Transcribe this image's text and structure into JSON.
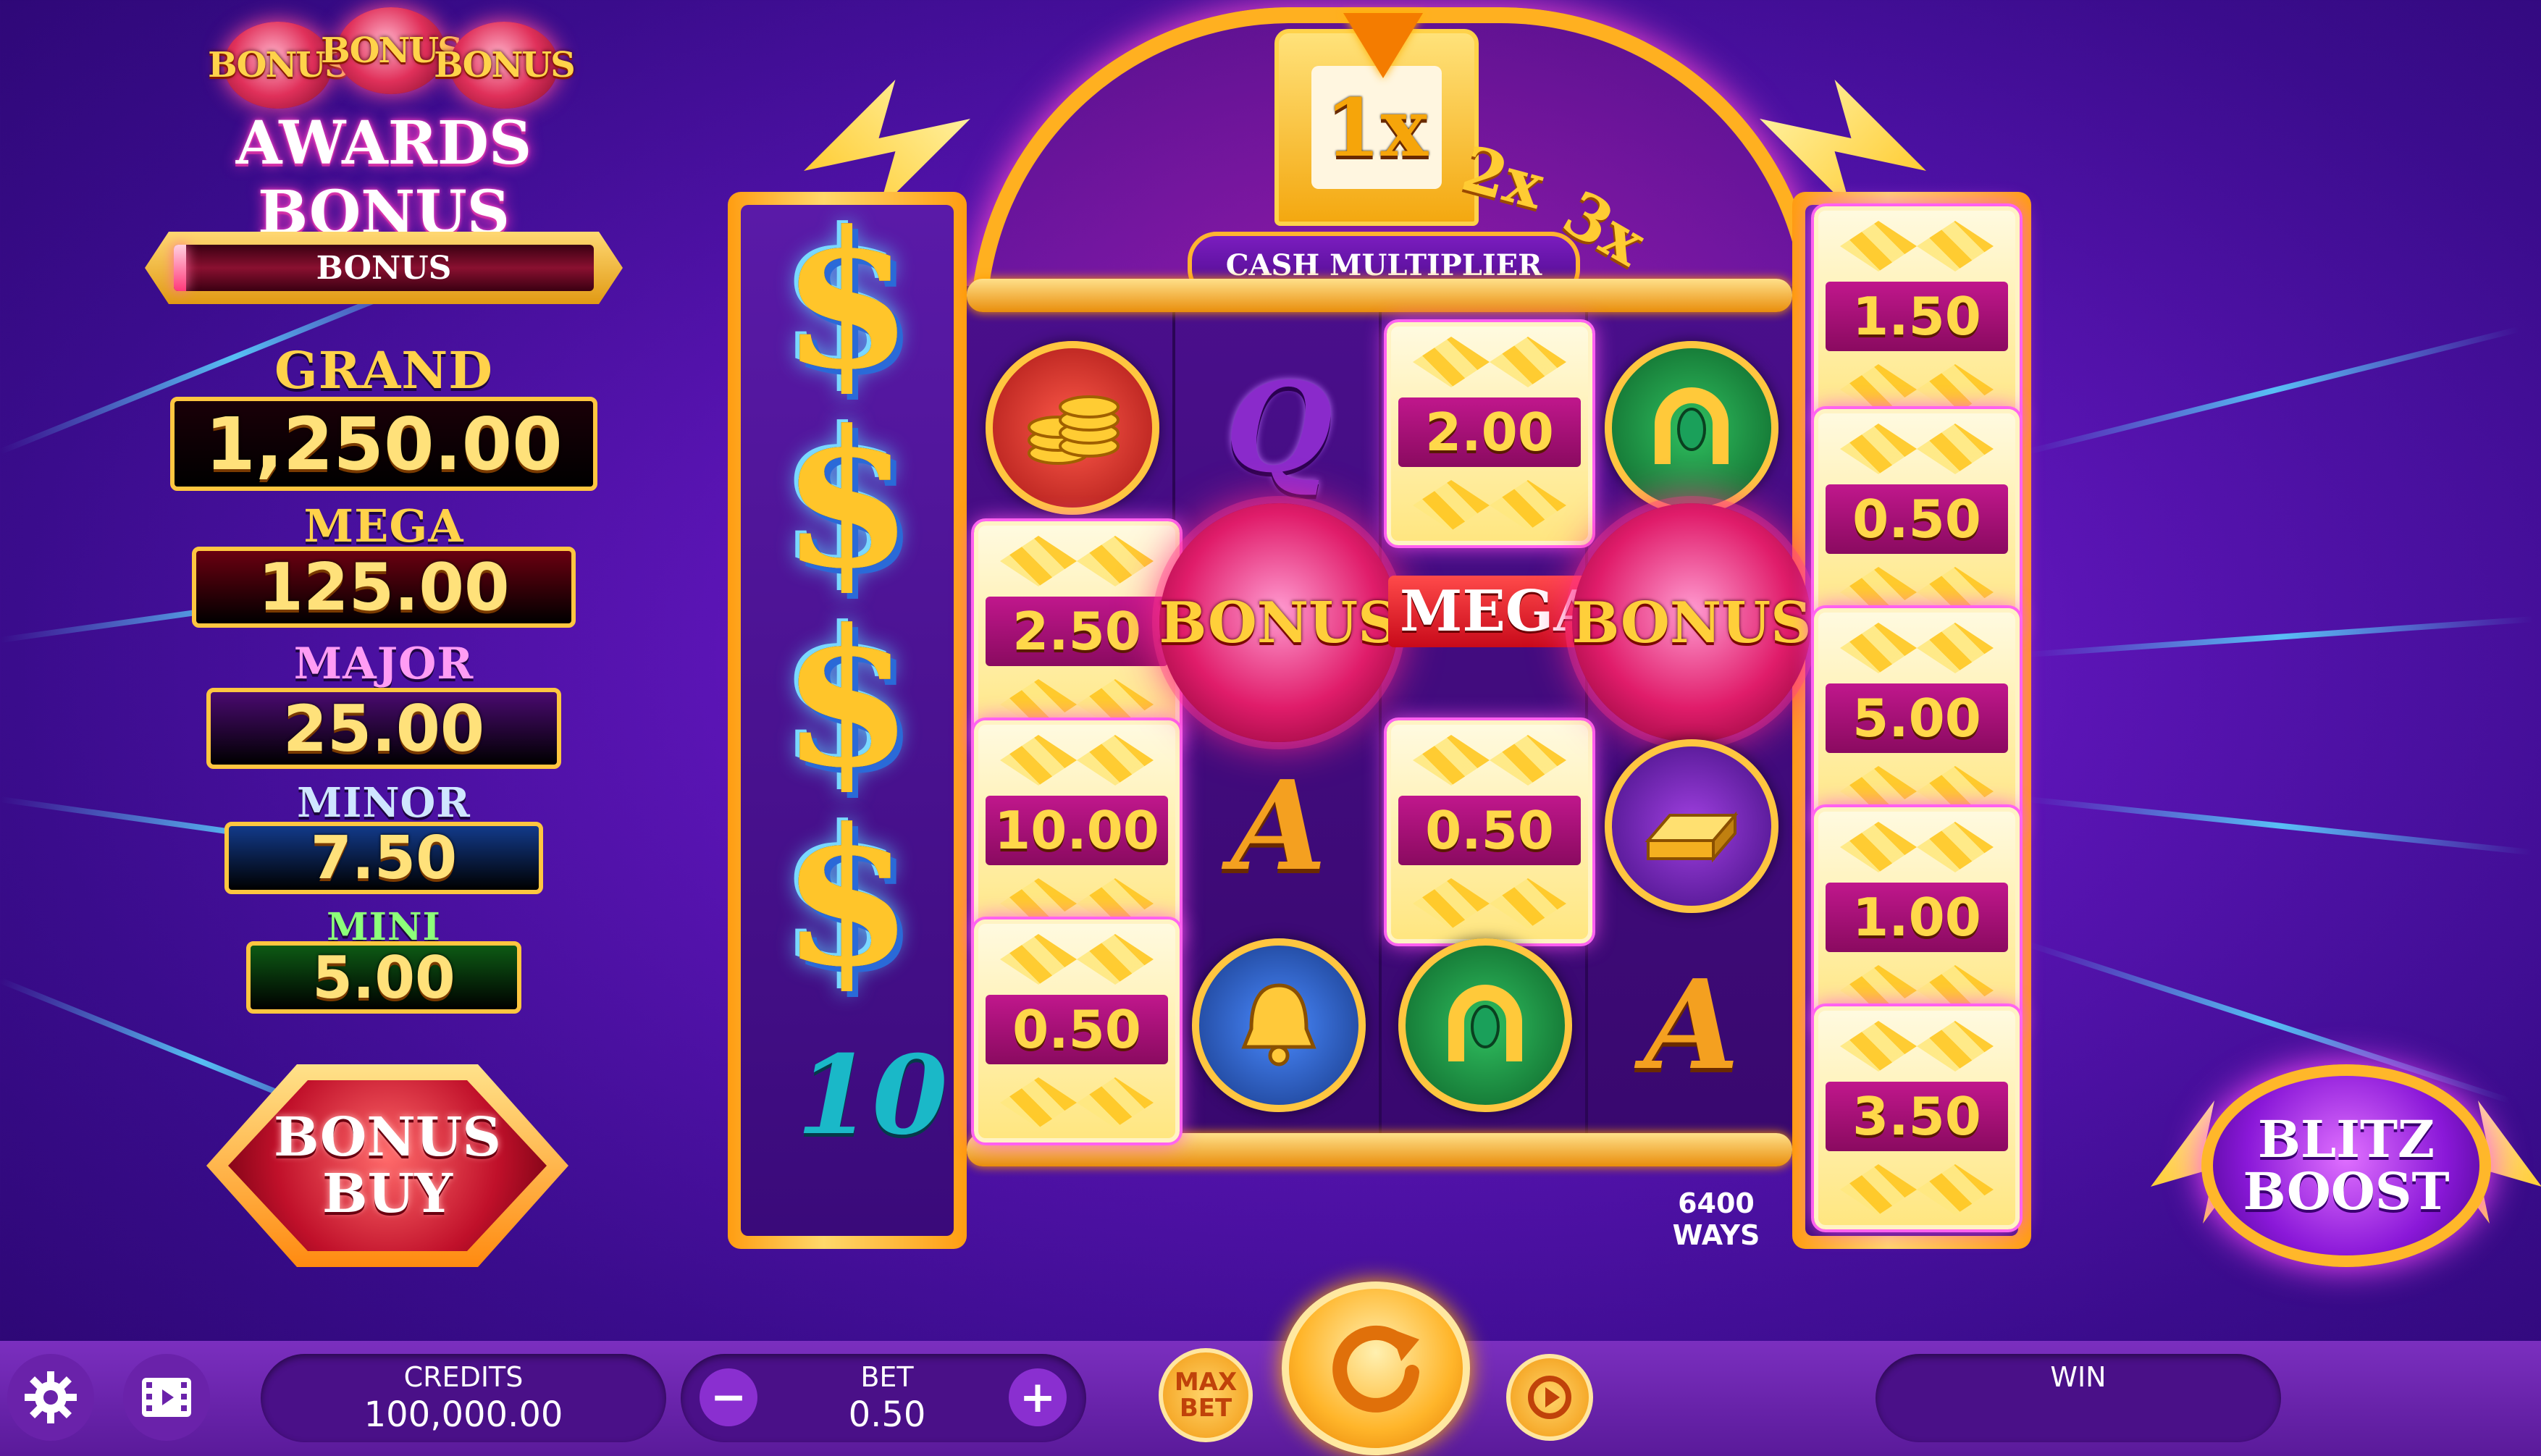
{
  "logo": {
    "bonus_words": [
      "BONUS",
      "BONUS",
      "BONUS"
    ],
    "title": "AWARDS BONUS"
  },
  "bonus_meter": {
    "label": "BONUS",
    "progress_fraction": 0.03
  },
  "jackpots": [
    {
      "name": "GRAND",
      "value": "1,250.00",
      "label_color": "#ffd24a",
      "box_color": "#1a0008"
    },
    {
      "name": "MEGA",
      "value": "125.00",
      "label_color": "#ffd24a",
      "box_color": "#6a0010"
    },
    {
      "name": "MAJOR",
      "value": "25.00",
      "label_color": "#ff9cf4",
      "box_color": "#4a0a70"
    },
    {
      "name": "MINOR",
      "value": "7.50",
      "label_color": "#cfe6ff",
      "box_color": "#123a8a"
    },
    {
      "name": "MINI",
      "value": "5.00",
      "label_color": "#8dff7a",
      "box_color": "#0d5a14"
    }
  ],
  "bonus_buy": {
    "line1": "BONUS",
    "line2": "BUY"
  },
  "multiplier": {
    "active": "1x",
    "others": [
      "2x",
      "3x"
    ],
    "label": "CASH MULTIPLIER"
  },
  "reels": {
    "col1_money": [
      "2.50",
      "10.00",
      "0.50"
    ],
    "col2_symbols": [
      "Q",
      "A"
    ],
    "col3_money": [
      "2.00",
      "0.50"
    ],
    "col3_mega": "MEGA",
    "bonus_symbol_text": "BONUS",
    "col5_symbol": "A",
    "left_symbol": "10",
    "right_money": [
      "1.50",
      "0.50",
      "5.00",
      "1.00",
      "3.50"
    ]
  },
  "ways": {
    "count": "6400",
    "label": "WAYS"
  },
  "blitz": {
    "line1": "BLITZ",
    "line2": "BOOST",
    "tm": "™"
  },
  "bottom_bar": {
    "credits_label": "CREDITS",
    "credits_value": "100,000.00",
    "bet_label": "BET",
    "bet_value": "0.50",
    "minus": "−",
    "plus": "+",
    "max_bet_line1": "MAX",
    "max_bet_line2": "BET",
    "win_label": "WIN"
  },
  "icons": {
    "settings": "gear-icon",
    "video": "film-icon",
    "spin": "spin-arrow-icon",
    "autoplay": "autoplay-icon"
  },
  "colors": {
    "background": "#5a14b4",
    "gold": "#ffb020",
    "bottom_bar": "#6a22aa"
  }
}
